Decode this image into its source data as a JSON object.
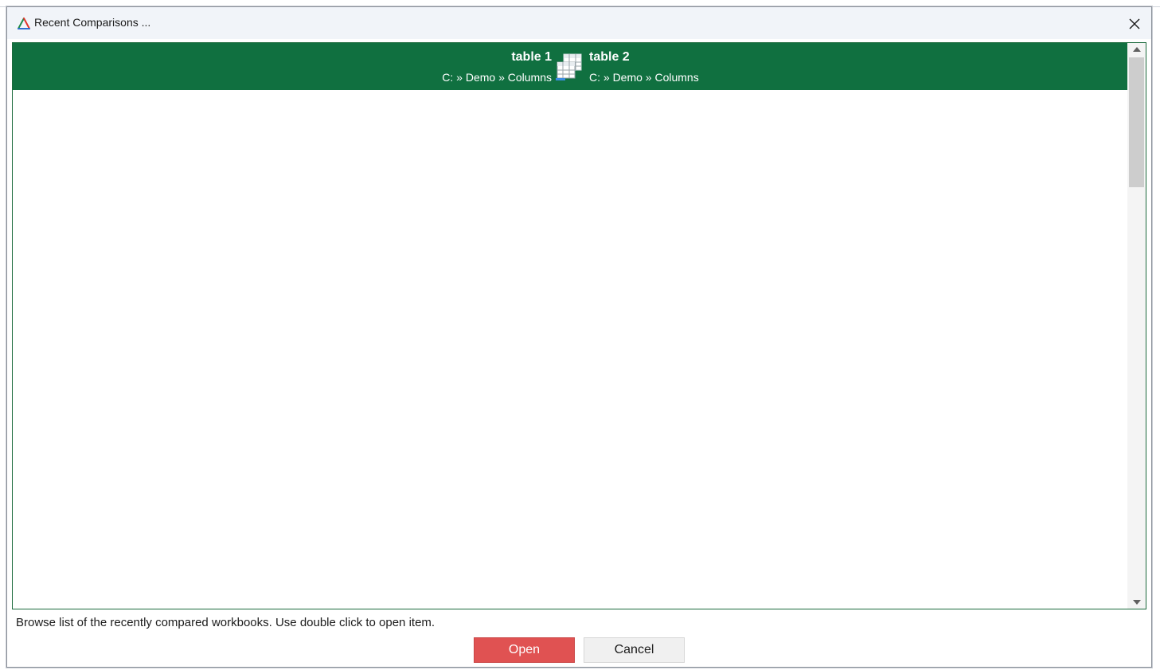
{
  "window": {
    "title": "Recent Comparisons ...",
    "logo_icon": "triangle-logo-icon",
    "close_icon": "close-icon"
  },
  "recent_list": {
    "items": [
      {
        "left_name": "table 1",
        "left_path": "C: » Demo » Columns",
        "right_name": "table 2",
        "right_path": "C: » Demo » Columns",
        "icon": "compare-tables-icon",
        "selected": true
      }
    ],
    "colors": {
      "selected_background": "#107040",
      "selected_text": "#ffffff",
      "border": "#1b6a3c"
    }
  },
  "footer": {
    "hint": "Browse list of the recently compared workbooks. Use double click to open item.",
    "open_label": "Open",
    "cancel_label": "Cancel",
    "open_color": "#e05252"
  }
}
